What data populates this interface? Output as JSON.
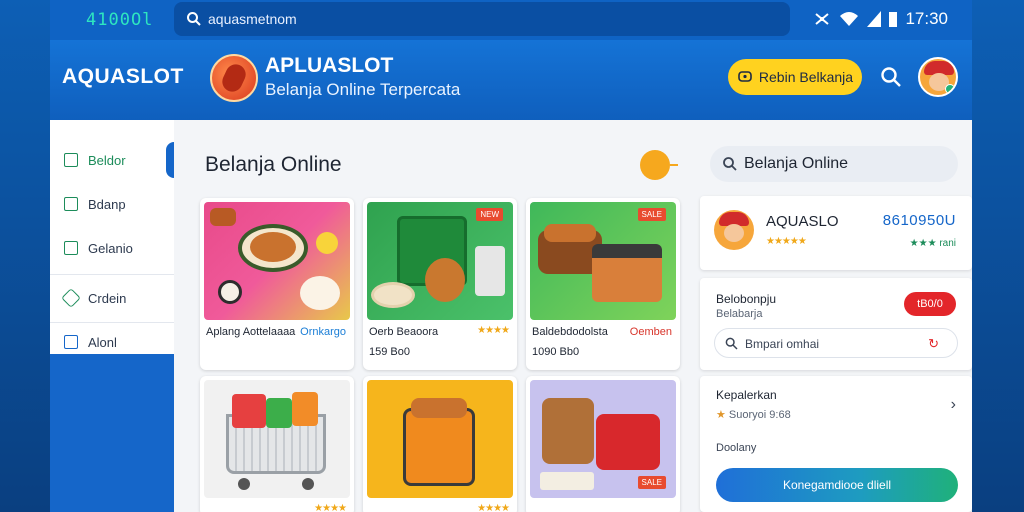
{
  "status_bar": {
    "left_text": "4100Ol",
    "url": "aquasmetnom",
    "time": "17:30"
  },
  "header": {
    "brand": "AQUASLOT",
    "title": "APLUASLOT",
    "subtitle": "Belanja Online Terpercata",
    "action_button": "Rebin Belkanja"
  },
  "sidebar": {
    "items": [
      {
        "label": "Beldor"
      },
      {
        "label": "Bdanp"
      },
      {
        "label": "Gelanio"
      },
      {
        "label": "Crdein"
      },
      {
        "label": "Alonl"
      }
    ]
  },
  "main": {
    "title": "Belanja Online"
  },
  "products": [
    {
      "name": "Aplang Aottelaaaa",
      "extra": "Ornkargo",
      "price": "",
      "stars": ""
    },
    {
      "name": "Oerb Beaoora",
      "extra": "",
      "price": "159 Bo0",
      "stars": "★★★★"
    },
    {
      "name": "Baldebdodolsta",
      "extra": "Oemben",
      "price": "1090 Bb0",
      "stars": ""
    },
    {
      "name": "",
      "extra": "",
      "price": "",
      "stars": "★★★★"
    },
    {
      "name": "",
      "extra": "",
      "price": "",
      "stars": "★★★★"
    },
    {
      "name": "",
      "extra": "",
      "price": "",
      "stars": ""
    }
  ],
  "right_panel": {
    "search": "Belanja Online",
    "seller": {
      "name": "AQUASLO",
      "stars": "★★★★★",
      "number": "8610950U",
      "rating": "★★★ rani"
    },
    "promo": {
      "title": "Belobonpju",
      "subtitle": "Belabarja",
      "pill": "tB0/0",
      "input": "Bmpari omhai"
    },
    "shipping": {
      "title": "Kepalerkan",
      "info": "Suoryoi 9:68",
      "label": "Doolany",
      "cta": "Konegamdiooe dliell"
    }
  },
  "colors": {
    "primary": "#1566c9",
    "accent": "#ffd21f",
    "danger": "#e3262a",
    "success": "#1c8c5a"
  }
}
